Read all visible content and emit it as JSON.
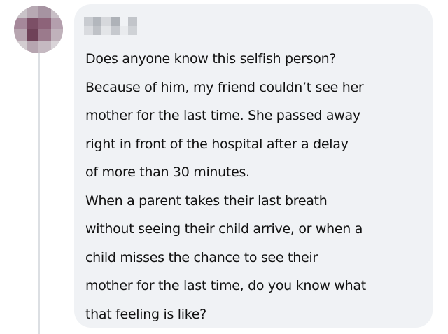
{
  "comment": {
    "author_name": "",
    "lines": [
      "Does anyone know this selfish person?",
      "Because of him, my friend couldn’t see her",
      "mother for the last time. She passed away",
      "right in front of the hospital after a delay",
      "of more than 30 minutes.",
      "When a parent takes their last breath",
      "without seeing their child arrive, or when a",
      "child misses the chance to see their",
      "mother for the last time, do you know what",
      "that feeling is like?"
    ]
  },
  "colors": {
    "bubble_background": "#f0f2f5",
    "thread_line": "#dcdfe3",
    "text": "#111111"
  },
  "icons": {
    "avatar": "blurred-profile-picture",
    "author_name": "pixelated-redacted-name"
  }
}
